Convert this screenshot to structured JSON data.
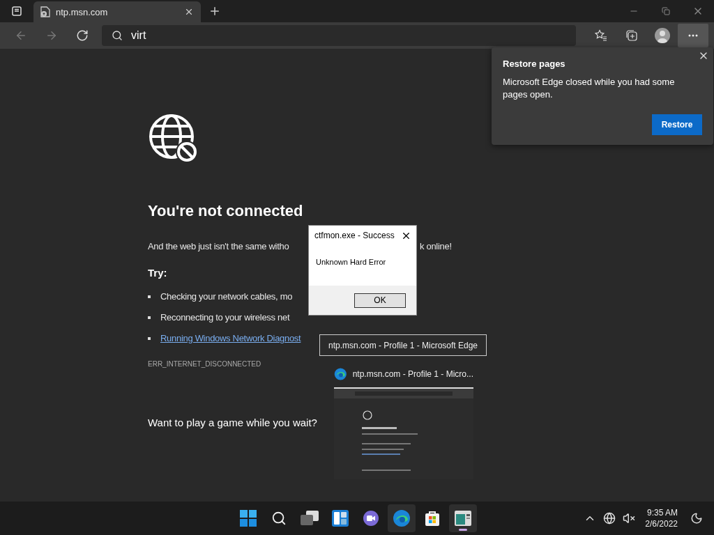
{
  "tab_bar": {
    "tabs": [
      {
        "title": "ntp.msn.com",
        "selected": true
      }
    ]
  },
  "address_bar": {
    "value": "virt"
  },
  "restore_popup": {
    "title": "Restore pages",
    "message": "Microsoft Edge closed while you had some pages open.",
    "button": "Restore"
  },
  "error_page": {
    "heading": "You're not connected",
    "message_parts": [
      "And the web just isn't the same witho",
      "k online!"
    ],
    "try_label": "Try:",
    "suggestions": [
      {
        "kind": "text",
        "text": "Checking your network cables, mo"
      },
      {
        "kind": "text",
        "text": "Reconnecting to your wireless net"
      },
      {
        "kind": "link",
        "text": "Running Windows Network Diagnost"
      }
    ],
    "error_code": "ERR_INTERNET_DISCONNECTED",
    "game_prompt": "Want to play a game while you wait?"
  },
  "dialog": {
    "title": "ctfmon.exe - Success",
    "message": "Unknown Hard Error",
    "button": "OK"
  },
  "taskbar": {
    "tooltip": "ntp.msn.com - Profile 1 - Microsoft Edge",
    "preview_title": "ntp.msn.com - Profile 1 - Micro...",
    "apps": [
      {
        "kind": "start",
        "highlighted": false,
        "running": false
      },
      {
        "kind": "search",
        "highlighted": false,
        "running": false
      },
      {
        "kind": "taskview",
        "highlighted": false,
        "running": false
      },
      {
        "kind": "widgets",
        "highlighted": false,
        "running": false
      },
      {
        "kind": "chat",
        "highlighted": false,
        "running": false
      },
      {
        "kind": "edge",
        "highlighted": true,
        "running": false
      },
      {
        "kind": "store",
        "highlighted": false,
        "running": false
      },
      {
        "kind": "app",
        "highlighted": true,
        "running": true
      }
    ],
    "time": "9:35 AM",
    "date": "2/6/2022"
  }
}
